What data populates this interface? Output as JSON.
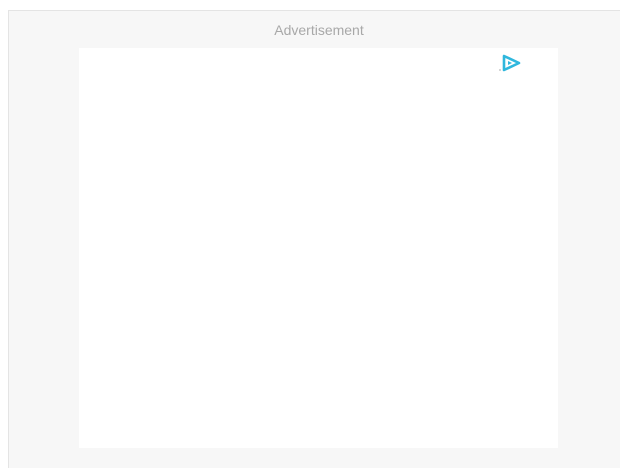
{
  "ad": {
    "label": "Advertisement",
    "icon": "adchoices-play-icon",
    "accent_color": "#2fb7dd"
  }
}
